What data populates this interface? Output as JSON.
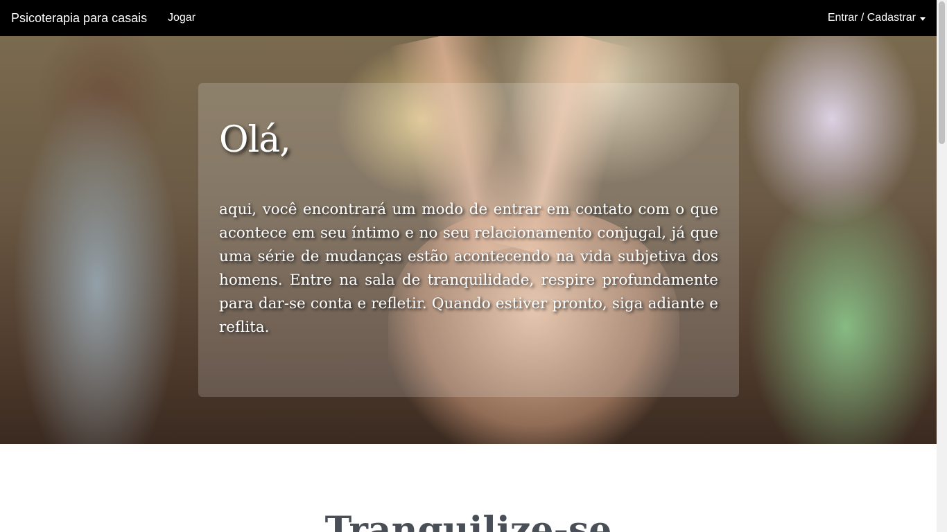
{
  "navbar": {
    "brand": "Psicoterapia para casais",
    "links": [
      {
        "label": "Jogar"
      }
    ],
    "account_label": "Entrar / Cadastrar"
  },
  "hero": {
    "title": "Olá,",
    "text": "aqui, você encontrará um modo de entrar em contato com o que acontece em seu íntimo e no seu relacionamento conjugal, já que uma série de mudanças estão acontecendo na vida subjetiva dos homens. Entre na sala de tranquilidade, respire profundamente para dar-se conta e refletir. Quando estiver pronto, siga adiante e reflita."
  },
  "section": {
    "title": "Tranquilize-se"
  },
  "colors": {
    "navbar_bg": "#000000",
    "heading_gray": "#4a4e57"
  }
}
